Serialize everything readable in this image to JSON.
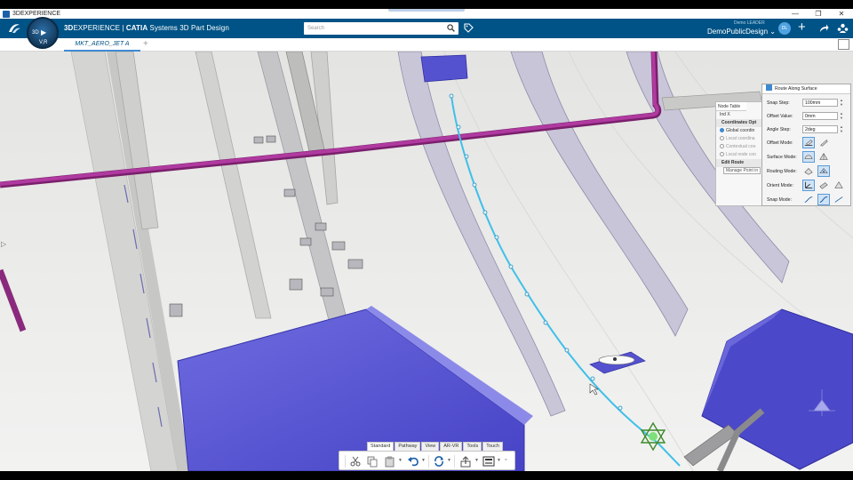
{
  "window": {
    "title": "3DEXPERIENCE",
    "controls": [
      "—",
      "❐",
      "✕"
    ]
  },
  "header": {
    "brand_bold": "3D",
    "brand_experience": "EXPERIENCE | ",
    "brand_catia": "CATIA",
    "brand_app": " Systems 3D Part Design",
    "search_placeholder": "Search",
    "user_name": "Demo  LEADER",
    "workspace": "DemoPublicDesign",
    "avatar_initials": "DL",
    "compass_3d": "3D",
    "compass_vr": "V,R"
  },
  "tabs": [
    {
      "label": "MKT_AERO_JET A",
      "active": true
    }
  ],
  "node_table": {
    "title": "Node Table",
    "row_label": "Ind  X",
    "coord_section": "Coordinates Opt",
    "coord_options": [
      {
        "label": "Global coordin",
        "selected": true
      },
      {
        "label": "Local coordina",
        "selected": false
      },
      {
        "label": "Contextual coo",
        "selected": false
      },
      {
        "label": "Local node coo",
        "selected": false
      }
    ],
    "edit_section": "Edit Route",
    "manage_point": "Manage Point in"
  },
  "route_panel": {
    "title": "Route Along Surface",
    "snap_step_label": "Snap Step:",
    "snap_step_value": "100mm",
    "offset_value_label": "Offset Value:",
    "offset_value": "0mm",
    "angle_step_label": "Angle Step:",
    "angle_step_value": "2deg",
    "offset_mode_label": "Offset Mode:",
    "surface_mode_label": "Surface Mode:",
    "routing_mode_label": "Routing Mode:",
    "orient_mode_label": "Orient Mode:",
    "snap_mode_label": "Snap Mode:"
  },
  "toolbar": {
    "tabs": [
      {
        "label": "Standard",
        "active": true
      },
      {
        "label": "Pathway",
        "active": false
      },
      {
        "label": "View",
        "active": false
      },
      {
        "label": "AR-VR",
        "active": false
      },
      {
        "label": "Tools",
        "active": false
      },
      {
        "label": "Touch",
        "active": false
      }
    ],
    "icons": [
      "cut-icon",
      "copy-icon",
      "paste-icon",
      "undo-icon",
      "update-icon",
      "share-icon",
      "display-icon"
    ]
  },
  "colors": {
    "header_bg": "#005386",
    "accent": "#3d8ad1",
    "pipe": "#9c2b8a",
    "box": "#5d5ad6",
    "route": "#3fc0e8"
  }
}
